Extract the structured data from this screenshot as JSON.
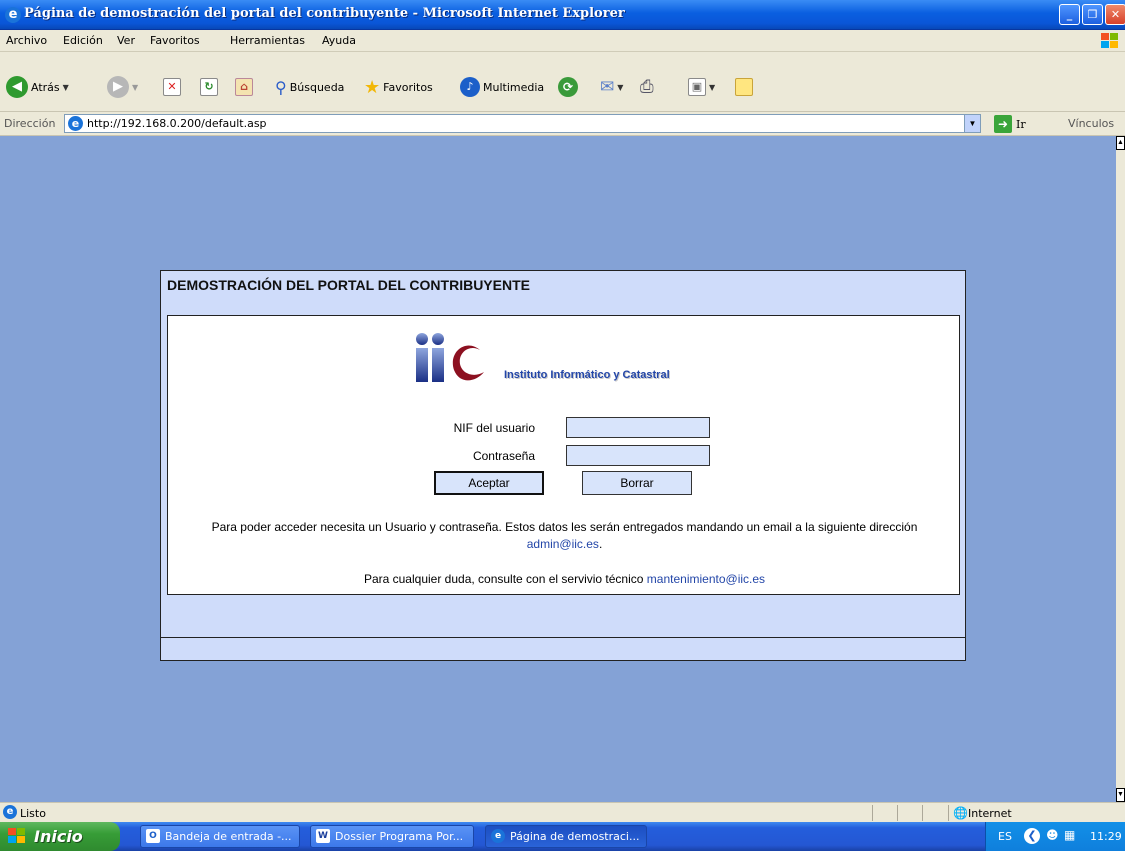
{
  "window": {
    "title": "Página de demostración del portal del contribuyente - Microsoft Internet Explorer"
  },
  "menu": [
    "Archivo",
    "Edición",
    "Ver",
    "Favoritos",
    "Herramientas",
    "Ayuda"
  ],
  "toolbar": {
    "back_label": "Atrás",
    "search_label": "Búsqueda",
    "favorites_label": "Favoritos",
    "media_label": "Multimedia"
  },
  "address": {
    "label": "Dirección",
    "url": "http://192.168.0.200/default.asp",
    "go_label": "Ir",
    "links_label": "Vínculos"
  },
  "portal": {
    "title": "DEMOSTRACIÓN DEL PORTAL DEL CONTRIBUYENTE",
    "logo_text": "Instituto Informático y Catastral",
    "nif_label": "NIF del usuario",
    "nif_value": "",
    "password_label": "Contraseña",
    "password_value": "",
    "accept_button": "Aceptar",
    "clear_button": "Borrar",
    "info_text_1": "Para poder acceder necesita un Usuario y contraseña. Estos datos les serán entregados mandando un email a la siguiente dirección",
    "info_email": "admin@iic.es",
    "info_text_2": "Para cualquier duda, consulte con el servivio técnico",
    "support_email": "mantenimiento@iic.es"
  },
  "status": {
    "text": "Listo",
    "zone": "Internet"
  },
  "taskbar": {
    "start_label": "Inicio",
    "tasks": [
      "Bandeja de entrada -...",
      "Dossier Programa Por...",
      "Página de demostraci..."
    ],
    "lang": "ES",
    "clock": "11:29"
  },
  "colors": {
    "page_background": "#84a2d6",
    "panel_background": "#cfdcfa",
    "link": "#2346a8"
  }
}
